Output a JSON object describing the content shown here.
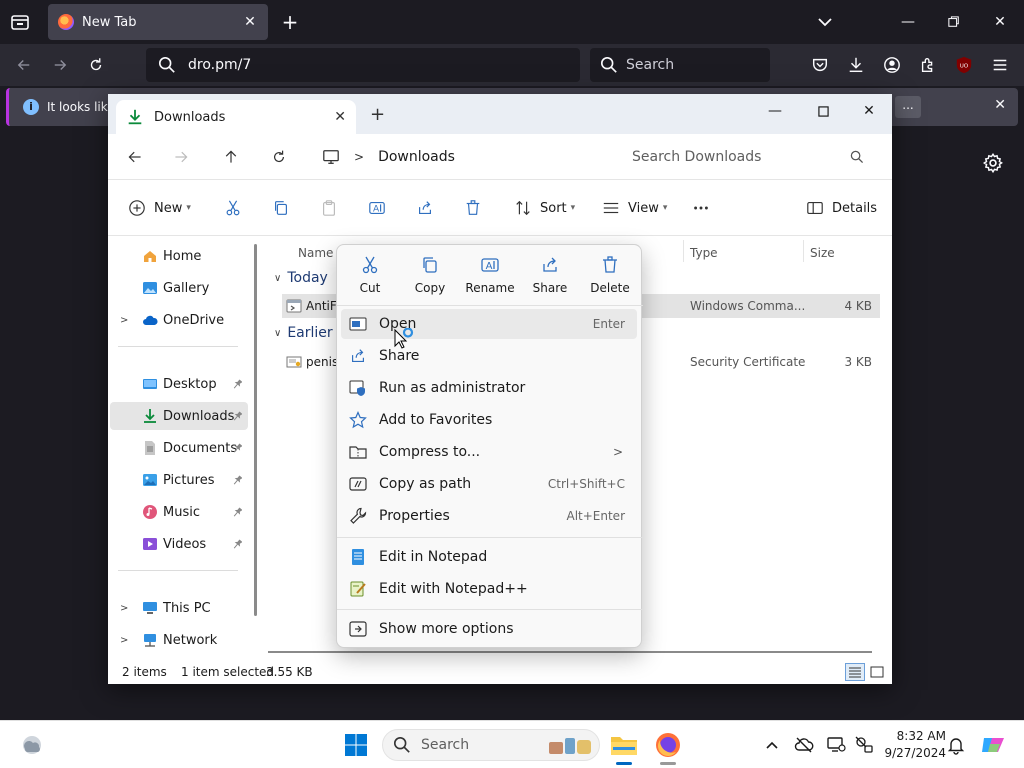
{
  "browser": {
    "tab_title": "New Tab",
    "url": "dro.pm/7",
    "search_placeholder": "Search",
    "notice_text": "It looks like",
    "notice_more": "..."
  },
  "explorer": {
    "tab_title": "Downloads",
    "path_current": "Downloads",
    "search_placeholder": "Search Downloads",
    "commands": {
      "new": "New",
      "sort": "Sort",
      "view": "View",
      "details": "Details"
    },
    "sidebar": {
      "home": "Home",
      "gallery": "Gallery",
      "onedrive": "OneDrive",
      "desktop": "Desktop",
      "downloads": "Downloads",
      "documents": "Documents",
      "pictures": "Pictures",
      "music": "Music",
      "videos": "Videos",
      "thispc": "This PC",
      "network": "Network"
    },
    "columns": {
      "name": "Name",
      "type": "Type",
      "size": "Size"
    },
    "groups": {
      "today": "Today",
      "earlier": "Earlier"
    },
    "files": [
      {
        "name": "AntiF",
        "type": "Windows Comma...",
        "size": "4 KB"
      },
      {
        "name": "penis",
        "type": "Security Certificate",
        "size": "3 KB"
      }
    ],
    "status": {
      "items": "2 items",
      "selected": "1 item selected",
      "size": "3.55 KB"
    }
  },
  "context_menu": {
    "quick": {
      "cut": "Cut",
      "copy": "Copy",
      "rename": "Rename",
      "share": "Share",
      "delete": "Delete"
    },
    "items": {
      "open": "Open",
      "open_acc": "Enter",
      "share": "Share",
      "run_admin": "Run as administrator",
      "favorites": "Add to Favorites",
      "compress": "Compress to...",
      "copy_path": "Copy as path",
      "copy_path_acc": "Ctrl+Shift+C",
      "properties": "Properties",
      "properties_acc": "Alt+Enter",
      "notepad": "Edit in Notepad",
      "notepadpp": "Edit with Notepad++",
      "more": "Show more options"
    }
  },
  "taskbar": {
    "search_placeholder": "Search",
    "time": "8:32 AM",
    "date": "9/27/2024"
  },
  "colors": {
    "accent": "#0067c0",
    "browser_bg": "#1c1b22",
    "toolbar_bg": "#2b2a33"
  }
}
